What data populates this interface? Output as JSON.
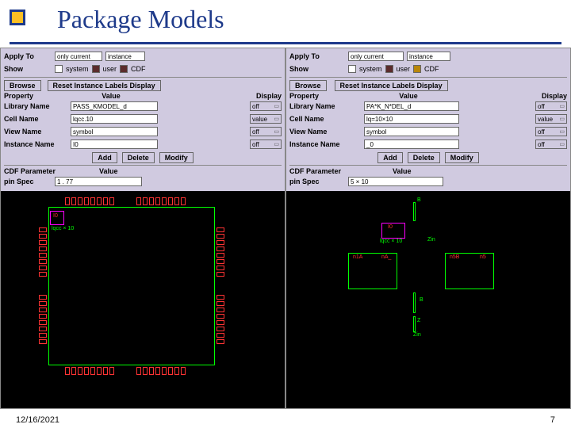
{
  "slide": {
    "title": "Package Models",
    "date": "12/16/2021",
    "page": "7"
  },
  "left": {
    "applyTo": "Apply To",
    "onlyCurrent": "only current",
    "instance": "instance",
    "show": "Show",
    "system": "system",
    "user": "user",
    "cdf": "CDF",
    "browse": "Browse",
    "reset": "Reset Instance Labels Display",
    "col_property": "Property",
    "col_value": "Value",
    "col_display": "Display",
    "rows": {
      "libName": {
        "label": "Library Name",
        "value": "PASS_KMODEL_d",
        "disp": "off"
      },
      "cellName": {
        "label": "Cell Name",
        "value": "lqcc.10",
        "disp": "value"
      },
      "viewName": {
        "label": "View Name",
        "value": "symbol",
        "disp": "off"
      },
      "instName": {
        "label": "Instance Name",
        "value": "I0",
        "disp": "off"
      }
    },
    "add": "Add",
    "delete": "Delete",
    "modify": "Modify",
    "cdfParam": "CDF Parameter",
    "value2": "Value",
    "pinSpec": "pin Spec",
    "pinSpecVal": "1 . 77",
    "canvas": {
      "inst": "I0",
      "cell": "lqcc × 10"
    }
  },
  "right": {
    "applyTo": "Apply To",
    "onlyCurrent": "only current",
    "instance": "instance",
    "show": "Show",
    "system": "system",
    "user": "user",
    "cdf": "CDF",
    "browse": "Browse",
    "reset": "Reset Instance Labels Display",
    "col_property": "Property",
    "col_value": "Value",
    "col_display": "Display",
    "rows": {
      "libName": {
        "label": "Library Name",
        "value": "PA*K_N*DEL_d",
        "disp": "off"
      },
      "cellName": {
        "label": "Cell Name",
        "value": "lq=10×10",
        "disp": "value"
      },
      "viewName": {
        "label": "View Name",
        "value": "symbol",
        "disp": "off"
      },
      "instName": {
        "label": "Instance Name",
        "value": "_0",
        "disp": "off"
      }
    },
    "add": "Add",
    "delete": "Delete",
    "modify": "Modify",
    "cdfParam": "CDF Parameter",
    "value2": "Value",
    "pinSpec": "pin Spec",
    "pinSpecVal": "5 × 10",
    "canvas": {
      "inst": "I0",
      "cell": "lqcc × 10",
      "B": "B",
      "Z": "Z",
      "Zin": "Zin",
      "n1A": "n1A",
      "nA_": "nA_",
      "n5B": "n5B",
      "n5": "n5"
    }
  }
}
